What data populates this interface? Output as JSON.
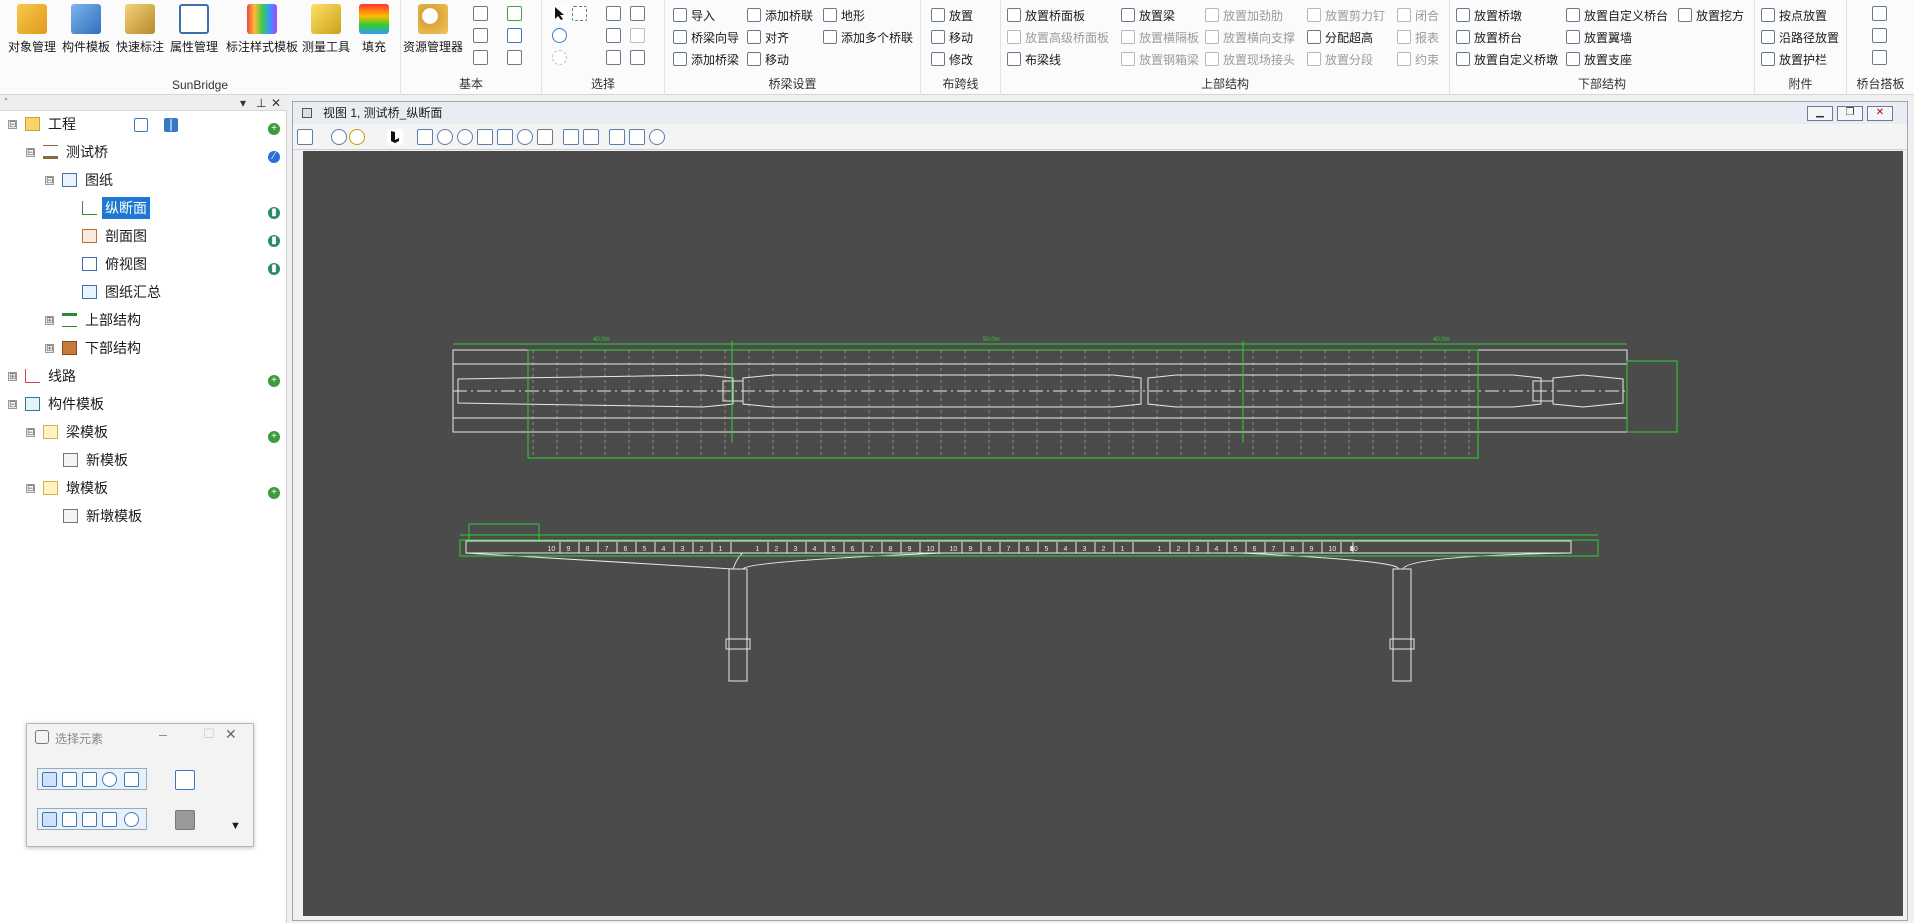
{
  "ribbon": {
    "groups": [
      {
        "label": "SunBridge",
        "buttons": [
          "对象管理",
          "构件模板",
          "快速标注",
          "属性管理",
          "标注样式模板",
          "测量工具",
          "填充"
        ]
      },
      {
        "label": "基本",
        "buttons": [
          "资源管理器"
        ]
      },
      {
        "label": "选择"
      },
      {
        "label": "桥梁设置",
        "items": [
          "导入",
          "添加桥联",
          "地形",
          "桥梁向导",
          "对齐",
          "添加多个桥联",
          "添加桥梁",
          "移动"
        ]
      },
      {
        "label": "布跨线",
        "items": [
          "放置",
          "移动",
          "修改"
        ]
      },
      {
        "label": "上部结构",
        "items": [
          "放置桥面板",
          "放置梁",
          "放置加劲肋",
          "放置剪力钉",
          "闭合",
          "放置高级桥面板",
          "放置横隔板",
          "放置横向支撑",
          "分配超高",
          "报表",
          "布梁线",
          "放置钢箱梁",
          "放置现场接头",
          "放置分段",
          "约束"
        ]
      },
      {
        "label": "下部结构",
        "items": [
          "放置桥墩",
          "放置自定义桥台",
          "放置挖方",
          "放置桥台",
          "放置翼墙",
          "放置自定义桥墩",
          "放置支座"
        ]
      },
      {
        "label": "附件",
        "items": [
          "按点放置",
          "沿路径放置",
          "放置护栏"
        ]
      },
      {
        "label": "桥台搭板"
      }
    ]
  },
  "tree": {
    "nodes": [
      {
        "label": "工程",
        "exp": "⊟"
      },
      {
        "label": "测试桥",
        "exp": "⊟"
      },
      {
        "label": "图纸",
        "exp": "⊟"
      },
      {
        "label": "纵断面"
      },
      {
        "label": "剖面图"
      },
      {
        "label": "俯视图"
      },
      {
        "label": "图纸汇总"
      },
      {
        "label": "上部结构",
        "exp": "⊞"
      },
      {
        "label": "下部结构",
        "exp": "⊞"
      },
      {
        "label": "线路",
        "exp": "⊞"
      },
      {
        "label": "构件模板",
        "exp": "⊟"
      },
      {
        "label": "梁模板",
        "exp": "⊟"
      },
      {
        "label": "新模板"
      },
      {
        "label": "墩模板",
        "exp": "⊟"
      },
      {
        "label": "新墩模板"
      }
    ]
  },
  "select_dialog": {
    "title": "选择元素"
  },
  "viewport": {
    "title": "视图 1, 测试桥_纵断面"
  },
  "drawing": {
    "upper_dims": [
      "40.0m",
      "50.0m",
      "40.0m"
    ],
    "segments_left": [
      "10",
      "9",
      "8",
      "7",
      "6",
      "5",
      "4",
      "3",
      "2",
      "1"
    ],
    "segments_right": [
      "1",
      "2",
      "3",
      "4",
      "5",
      "6",
      "7",
      "8",
      "9",
      "10"
    ]
  },
  "colors": {
    "canvas": "#4b4b4b",
    "selection": "#1e78d2",
    "drawing_line": "#e8e8e8",
    "dimension_line": "#2fd22f"
  }
}
